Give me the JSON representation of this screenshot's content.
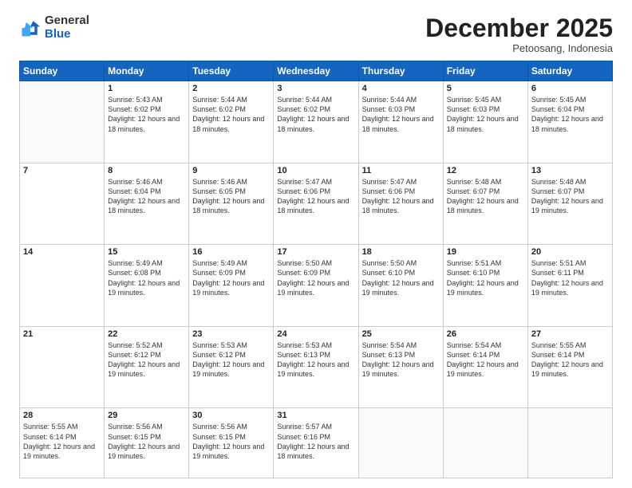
{
  "header": {
    "logo_general": "General",
    "logo_blue": "Blue",
    "month_title": "December 2025",
    "subtitle": "Petoosang, Indonesia"
  },
  "days_of_week": [
    "Sunday",
    "Monday",
    "Tuesday",
    "Wednesday",
    "Thursday",
    "Friday",
    "Saturday"
  ],
  "weeks": [
    [
      {
        "day": "",
        "info": ""
      },
      {
        "day": "1",
        "info": "Sunrise: 5:43 AM\nSunset: 6:02 PM\nDaylight: 12 hours and 18 minutes."
      },
      {
        "day": "2",
        "info": "Sunrise: 5:44 AM\nSunset: 6:02 PM\nDaylight: 12 hours and 18 minutes."
      },
      {
        "day": "3",
        "info": "Sunrise: 5:44 AM\nSunset: 6:02 PM\nDaylight: 12 hours and 18 minutes."
      },
      {
        "day": "4",
        "info": "Sunrise: 5:44 AM\nSunset: 6:03 PM\nDaylight: 12 hours and 18 minutes."
      },
      {
        "day": "5",
        "info": "Sunrise: 5:45 AM\nSunset: 6:03 PM\nDaylight: 12 hours and 18 minutes."
      },
      {
        "day": "6",
        "info": "Sunrise: 5:45 AM\nSunset: 6:04 PM\nDaylight: 12 hours and 18 minutes."
      }
    ],
    [
      {
        "day": "7",
        "info": ""
      },
      {
        "day": "8",
        "info": "Sunrise: 5:46 AM\nSunset: 6:04 PM\nDaylight: 12 hours and 18 minutes."
      },
      {
        "day": "9",
        "info": "Sunrise: 5:46 AM\nSunset: 6:05 PM\nDaylight: 12 hours and 18 minutes."
      },
      {
        "day": "10",
        "info": "Sunrise: 5:47 AM\nSunset: 6:06 PM\nDaylight: 12 hours and 18 minutes."
      },
      {
        "day": "11",
        "info": "Sunrise: 5:47 AM\nSunset: 6:06 PM\nDaylight: 12 hours and 18 minutes."
      },
      {
        "day": "12",
        "info": "Sunrise: 5:48 AM\nSunset: 6:07 PM\nDaylight: 12 hours and 18 minutes."
      },
      {
        "day": "13",
        "info": "Sunrise: 5:48 AM\nSunset: 6:07 PM\nDaylight: 12 hours and 19 minutes."
      }
    ],
    [
      {
        "day": "14",
        "info": ""
      },
      {
        "day": "15",
        "info": "Sunrise: 5:49 AM\nSunset: 6:08 PM\nDaylight: 12 hours and 19 minutes."
      },
      {
        "day": "16",
        "info": "Sunrise: 5:49 AM\nSunset: 6:09 PM\nDaylight: 12 hours and 19 minutes."
      },
      {
        "day": "17",
        "info": "Sunrise: 5:50 AM\nSunset: 6:09 PM\nDaylight: 12 hours and 19 minutes."
      },
      {
        "day": "18",
        "info": "Sunrise: 5:50 AM\nSunset: 6:10 PM\nDaylight: 12 hours and 19 minutes."
      },
      {
        "day": "19",
        "info": "Sunrise: 5:51 AM\nSunset: 6:10 PM\nDaylight: 12 hours and 19 minutes."
      },
      {
        "day": "20",
        "info": "Sunrise: 5:51 AM\nSunset: 6:11 PM\nDaylight: 12 hours and 19 minutes."
      }
    ],
    [
      {
        "day": "21",
        "info": ""
      },
      {
        "day": "22",
        "info": "Sunrise: 5:52 AM\nSunset: 6:12 PM\nDaylight: 12 hours and 19 minutes."
      },
      {
        "day": "23",
        "info": "Sunrise: 5:53 AM\nSunset: 6:12 PM\nDaylight: 12 hours and 19 minutes."
      },
      {
        "day": "24",
        "info": "Sunrise: 5:53 AM\nSunset: 6:13 PM\nDaylight: 12 hours and 19 minutes."
      },
      {
        "day": "25",
        "info": "Sunrise: 5:54 AM\nSunset: 6:13 PM\nDaylight: 12 hours and 19 minutes."
      },
      {
        "day": "26",
        "info": "Sunrise: 5:54 AM\nSunset: 6:14 PM\nDaylight: 12 hours and 19 minutes."
      },
      {
        "day": "27",
        "info": "Sunrise: 5:55 AM\nSunset: 6:14 PM\nDaylight: 12 hours and 19 minutes."
      }
    ],
    [
      {
        "day": "28",
        "info": "Sunrise: 5:55 AM\nSunset: 6:14 PM\nDaylight: 12 hours and 19 minutes."
      },
      {
        "day": "29",
        "info": "Sunrise: 5:56 AM\nSunset: 6:15 PM\nDaylight: 12 hours and 19 minutes."
      },
      {
        "day": "30",
        "info": "Sunrise: 5:56 AM\nSunset: 6:15 PM\nDaylight: 12 hours and 19 minutes."
      },
      {
        "day": "31",
        "info": "Sunrise: 5:57 AM\nSunset: 6:16 PM\nDaylight: 12 hours and 18 minutes."
      },
      {
        "day": "",
        "info": ""
      },
      {
        "day": "",
        "info": ""
      },
      {
        "day": "",
        "info": ""
      }
    ]
  ]
}
